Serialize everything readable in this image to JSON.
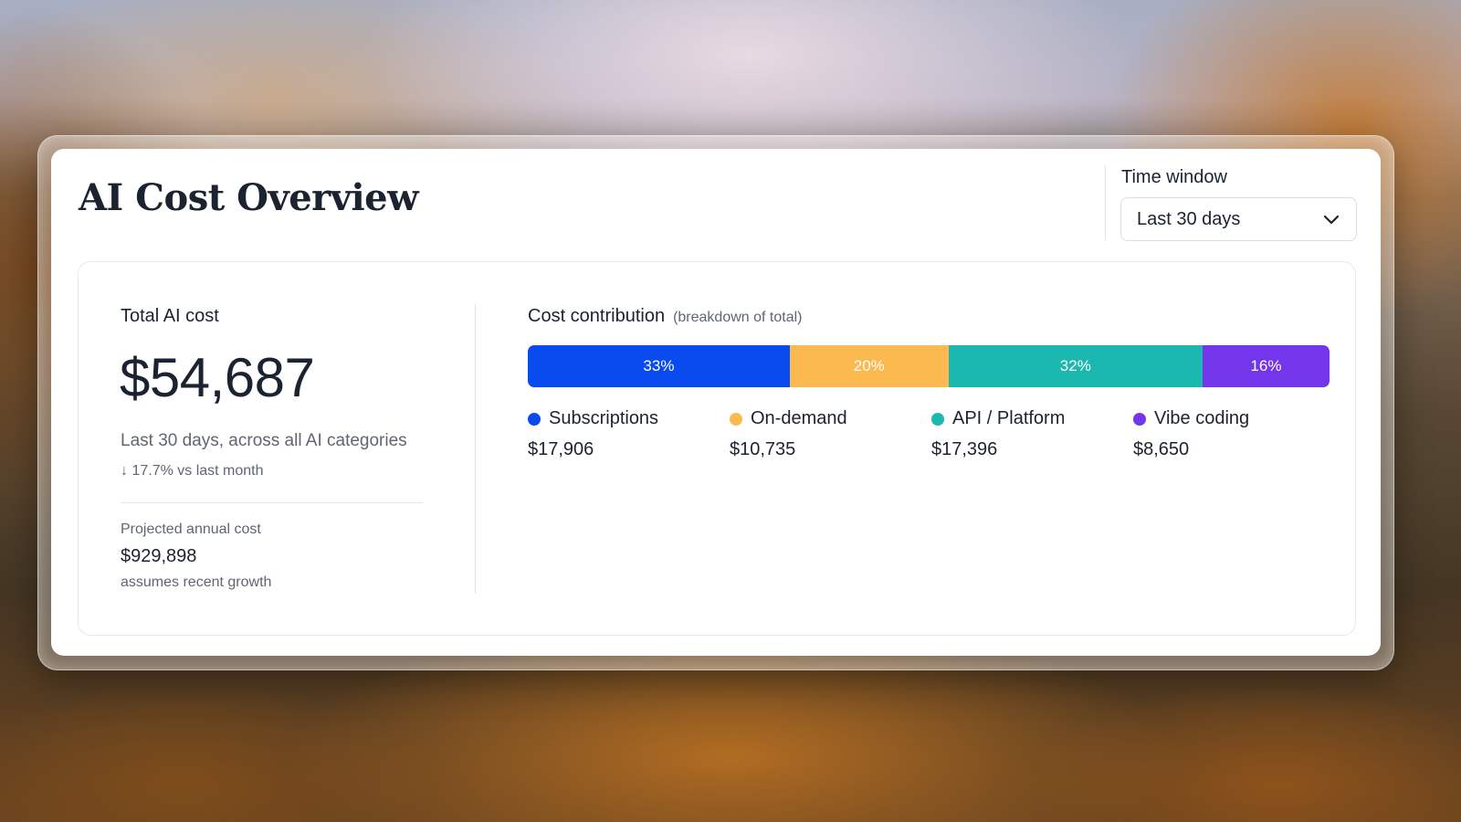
{
  "header": {
    "title": "AI Cost Overview"
  },
  "time_window": {
    "label": "Time window",
    "selected": "Last 30 days"
  },
  "summary": {
    "total_label": "Total AI cost",
    "total_value": "$54,687",
    "subtitle": "Last 30 days, across all AI categories",
    "delta": "↓ 17.7% vs last month",
    "projected_label": "Projected annual cost",
    "projected_value": "$929,898",
    "projected_note": "assumes recent growth"
  },
  "contribution": {
    "title": "Cost contribution",
    "subtitle": "(breakdown of total)",
    "segments": [
      {
        "name": "Subscriptions",
        "percent": 33,
        "percent_label": "33%",
        "amount": "$17,906",
        "color": "#0a4bf0"
      },
      {
        "name": "On-demand",
        "percent": 20,
        "percent_label": "20%",
        "amount": "$10,735",
        "color": "#fbb94f"
      },
      {
        "name": "API / Platform",
        "percent": 32,
        "percent_label": "32%",
        "amount": "$17,396",
        "color": "#1bb8b0"
      },
      {
        "name": "Vibe coding",
        "percent": 16,
        "percent_label": "16%",
        "amount": "$8,650",
        "color": "#7436ea"
      }
    ]
  },
  "icons": {
    "dropdown": "chevron-down-icon"
  }
}
